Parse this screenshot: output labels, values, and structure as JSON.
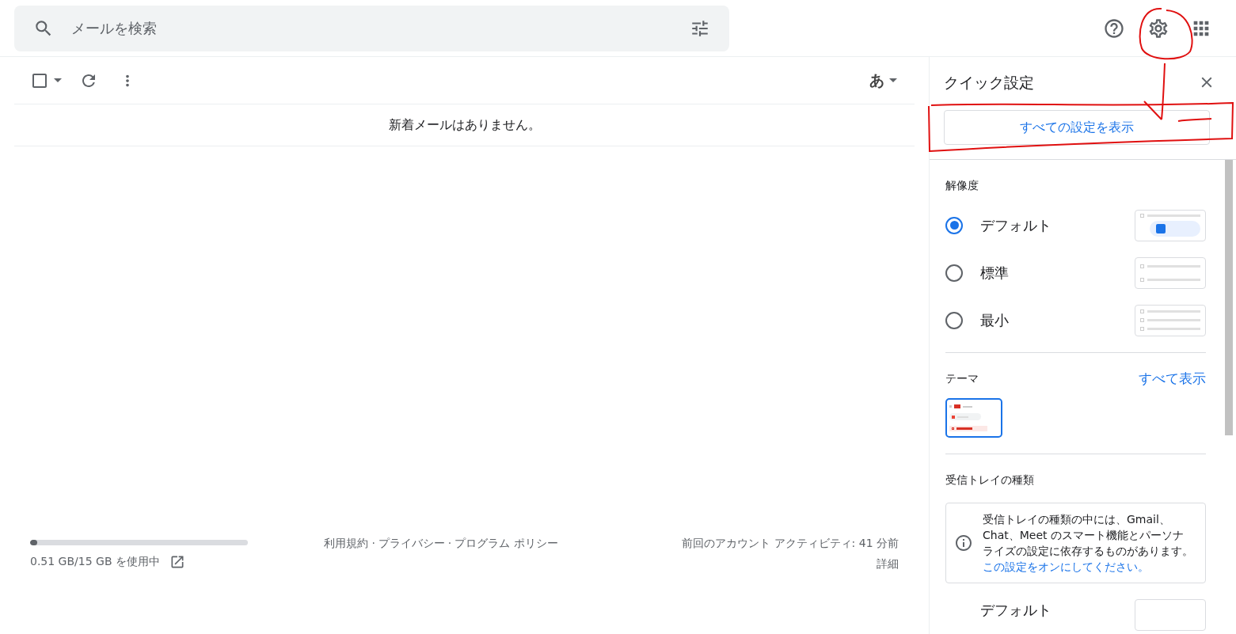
{
  "search": {
    "placeholder": "メールを検索"
  },
  "toolbar": {
    "input_tool": "あ"
  },
  "empty_message": "新着メールはありません。",
  "footer": {
    "storage": {
      "level": 0.034,
      "text": "0.51 GB/15 GB を使用中"
    },
    "separator": "·",
    "links": [
      "利用規約",
      "プライバシー",
      "プログラム ポリシー"
    ],
    "activity": "前回のアカウント アクティビティ: 41 分前",
    "details": "詳細"
  },
  "quick_settings": {
    "title": "クイック設定",
    "all_settings_button": "すべての設定を表示",
    "density": {
      "label": "解像度",
      "options": [
        {
          "label": "デフォルト",
          "selected": true,
          "kind": "default"
        },
        {
          "label": "標準",
          "selected": false,
          "kind": "comfortable"
        },
        {
          "label": "最小",
          "selected": false,
          "kind": "compact"
        }
      ]
    },
    "theme": {
      "label": "テーマ",
      "link": "すべて表示",
      "selected": true
    },
    "inbox_type": {
      "label": "受信トレイの種類",
      "info_text": "受信トレイの種類の中には、Gmail、Chat、Meet のスマート機能とパーソナライズの設定に依存するものがあります。",
      "info_link": "この設定をオンにしてください。",
      "options": [
        {
          "label": "デフォルト"
        }
      ]
    }
  }
}
